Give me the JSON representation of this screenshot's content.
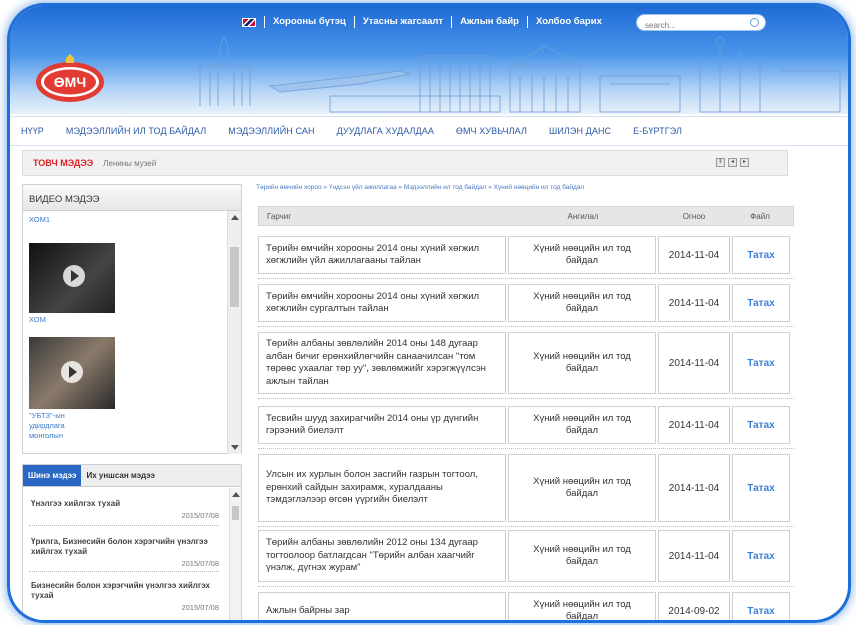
{
  "header": {
    "top_links": [
      "Хорооны бүтэц",
      "Утасны жагсаалт",
      "Ажлын байр",
      "Холбоо барих"
    ],
    "search_placeholder": "search...",
    "logo_text": "ӨМЧ"
  },
  "menu": [
    "НҮҮР",
    "МЭДЭЭЛЛИЙН ИЛ ТОД БАЙДАЛ",
    "МЭДЭЭЛЛИЙН САН",
    "ДУУДЛАГА ХУДАЛДАА",
    "ӨМЧ ХУВЬЧЛАЛ",
    "ШИЛЭН ДАНС",
    "Е-БҮРТГЭЛ"
  ],
  "ticker": {
    "title": "ТОВЧ МЭДЭЭ",
    "text": "Ленины музей"
  },
  "sidebar": {
    "video_title": "ВИДЕО МЭДЭЭ",
    "videos": [
      {
        "caption": "ХОМ1"
      },
      {
        "caption": "ХОМ"
      },
      {
        "caption": "\"УБТЗ\"-ын удирдлага монголын"
      }
    ],
    "news_tabs": [
      "Шинэ мэдээ",
      "Их уншсан мэдээ"
    ],
    "news": [
      {
        "title": "Үнэлгээ хийлгэх тухай",
        "date": "2015/07/08"
      },
      {
        "title": "Үрилга, Бизнесийн болон хэрэгчийн үнэлгээ хийлгэх тухай",
        "date": "2015/07/08"
      },
      {
        "title": "Бизнесийн болон хэрэгчийн үнэлгээ хийлгэх тухай",
        "date": "2015/07/08"
      }
    ]
  },
  "breadcrumb": "Төрийн өмчийн хороо » Үндсэн үйл ажиллагаа » Мэдээллийн ил тод байдал » Хүний нөөцийн ил тод байдал",
  "table": {
    "headers": [
      "Гарчиг",
      "Ангилал",
      "Огноо",
      "Файл"
    ],
    "rows": [
      {
        "title": "Төрийн өмчийн хорооны 2014 оны хүний хөгжил хөгжлийн үйл ажиллагааны тайлан",
        "category": "Хүний нөөцийн ил тод байдал",
        "date": "2014-11-04",
        "file": "Татах"
      },
      {
        "title": "Төрийн өмчийн хорооны 2014 оны хүний хөгжил хөгжлийн сургалтын тайлан",
        "category": "Хүний нөөцийн ил тод байдал",
        "date": "2014-11-04",
        "file": "Татах"
      },
      {
        "title": "Төрийн албаны зөвлөлийн 2014 оны 148 дугаар албан бичиг ерөнхийлөгчийн санаачилсан \"том төрөөс ухаалаг төр уу\", зөвлөмжийг хэрэгжүүлсэн ажлын тайлан",
        "category": "Хүний нөөцийн ил тод байдал",
        "date": "2014-11-04",
        "file": "Татах"
      },
      {
        "title": "Тесвийн шууд захирагчийн 2014 оны үр дүнгийн гэрээний биелэлт",
        "category": "Хүний нөөцийн ил тод байдал",
        "date": "2014-11-04",
        "file": "Татах"
      },
      {
        "title": "Улсын их хурлын болон засгийн газрын тогтоол, ерөнхий сайдын захирамж, хуралдааны тэмдэглэлээр өгсөн үүргийн биелэлт",
        "category": "Хүний нөөцийн ил тод байдал",
        "date": "2014-11-04",
        "file": "Татах"
      },
      {
        "title": "Төрийн албаны зөвлөлийн 2012 оны 134 дугаар тогтоолоор батлагдсан \"Төрийн албан хаагчийг үнэлж, дүгнэх журам\"",
        "category": "Хүний нөөцийн ил тод байдал",
        "date": "2014-11-04",
        "file": "Татах"
      },
      {
        "title": "Ажлын байрны зар",
        "category": "Хүний нөөцийн ил тод байдал",
        "date": "2014-09-02",
        "file": "Татах"
      }
    ]
  }
}
